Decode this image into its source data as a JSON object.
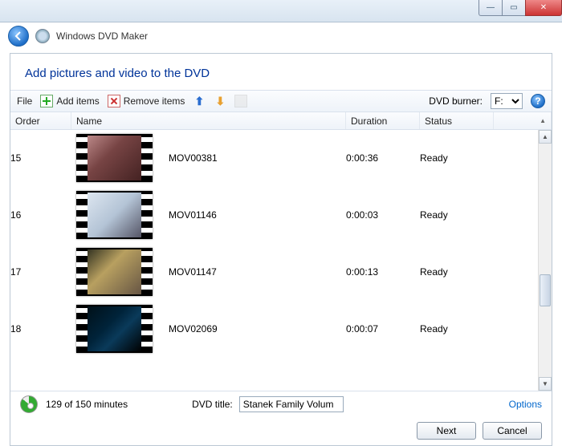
{
  "app": {
    "title": "Windows DVD Maker"
  },
  "page": {
    "heading": "Add pictures and video to the DVD"
  },
  "toolbar": {
    "file": "File",
    "add": "Add items",
    "remove": "Remove items",
    "burner_label": "DVD burner:",
    "burner_value": "F:"
  },
  "columns": {
    "order": "Order",
    "name": "Name",
    "duration": "Duration",
    "status": "Status"
  },
  "items": [
    {
      "order": "15",
      "name": "MOV00381",
      "duration": "0:00:36",
      "status": "Ready",
      "thumb": "a"
    },
    {
      "order": "16",
      "name": "MOV01146",
      "duration": "0:00:03",
      "status": "Ready",
      "thumb": "b"
    },
    {
      "order": "17",
      "name": "MOV01147",
      "duration": "0:00:13",
      "status": "Ready",
      "thumb": "c"
    },
    {
      "order": "18",
      "name": "MOV02069",
      "duration": "0:00:07",
      "status": "Ready",
      "thumb": "d"
    }
  ],
  "footer": {
    "usage": "129 of 150 minutes",
    "title_label": "DVD title:",
    "title_value": "Stanek Family Volum",
    "options": "Options"
  },
  "buttons": {
    "next": "Next",
    "cancel": "Cancel"
  }
}
